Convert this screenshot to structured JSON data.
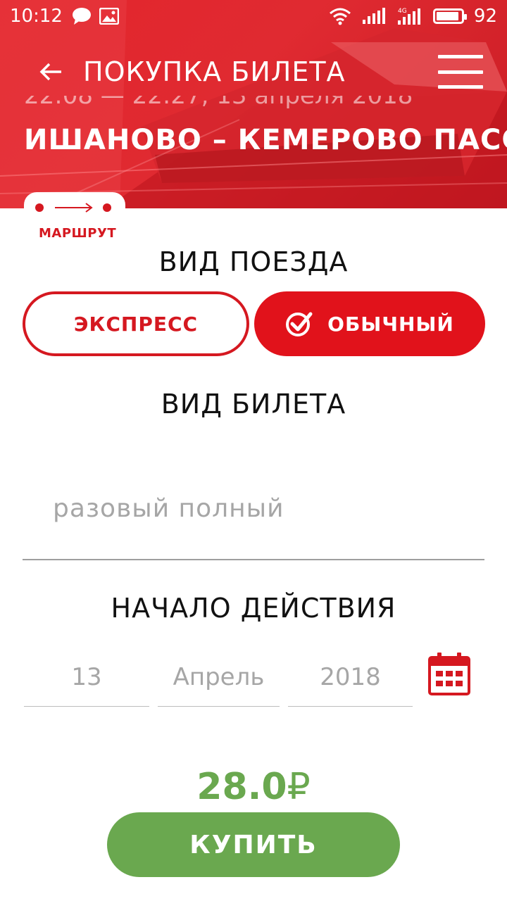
{
  "status_bar": {
    "time": "10:12",
    "battery": "92",
    "battery_level": 0.92,
    "network": "4G"
  },
  "header": {
    "title": "ПОКУПКА БИЛЕТА",
    "time_line": "22:08 — 22:27, 13 апреля 2018",
    "route": "ИШАНОВО – КЕМЕРОВО ПАСС",
    "route_tab_label": "МАРШРУТ"
  },
  "train_type": {
    "title": "ВИД ПОЕЗДА",
    "options": [
      "ЭКСПРЕСС",
      "ОБЫЧНЫЙ"
    ],
    "selected": "ОБЫЧНЫЙ"
  },
  "ticket_type": {
    "title": "ВИД БИЛЕТА",
    "value": "разовый полный"
  },
  "start_date": {
    "title": "НАЧАЛО ДЕЙСТВИЯ",
    "day": "13",
    "month": "Апрель",
    "year": "2018"
  },
  "price": {
    "amount": "28.0",
    "currency": "₽"
  },
  "buy_label": "КУПИТЬ",
  "colors": {
    "brand_red": "#e1121b",
    "accent_green": "#6aa84f",
    "placeholder_gray": "#a6a6a6"
  },
  "icons": [
    "back-arrow-icon",
    "menu-icon",
    "route-icon",
    "check-icon",
    "calendar-icon",
    "chat-icon",
    "image-icon",
    "wifi-icon",
    "signal-icon",
    "battery-icon"
  ]
}
